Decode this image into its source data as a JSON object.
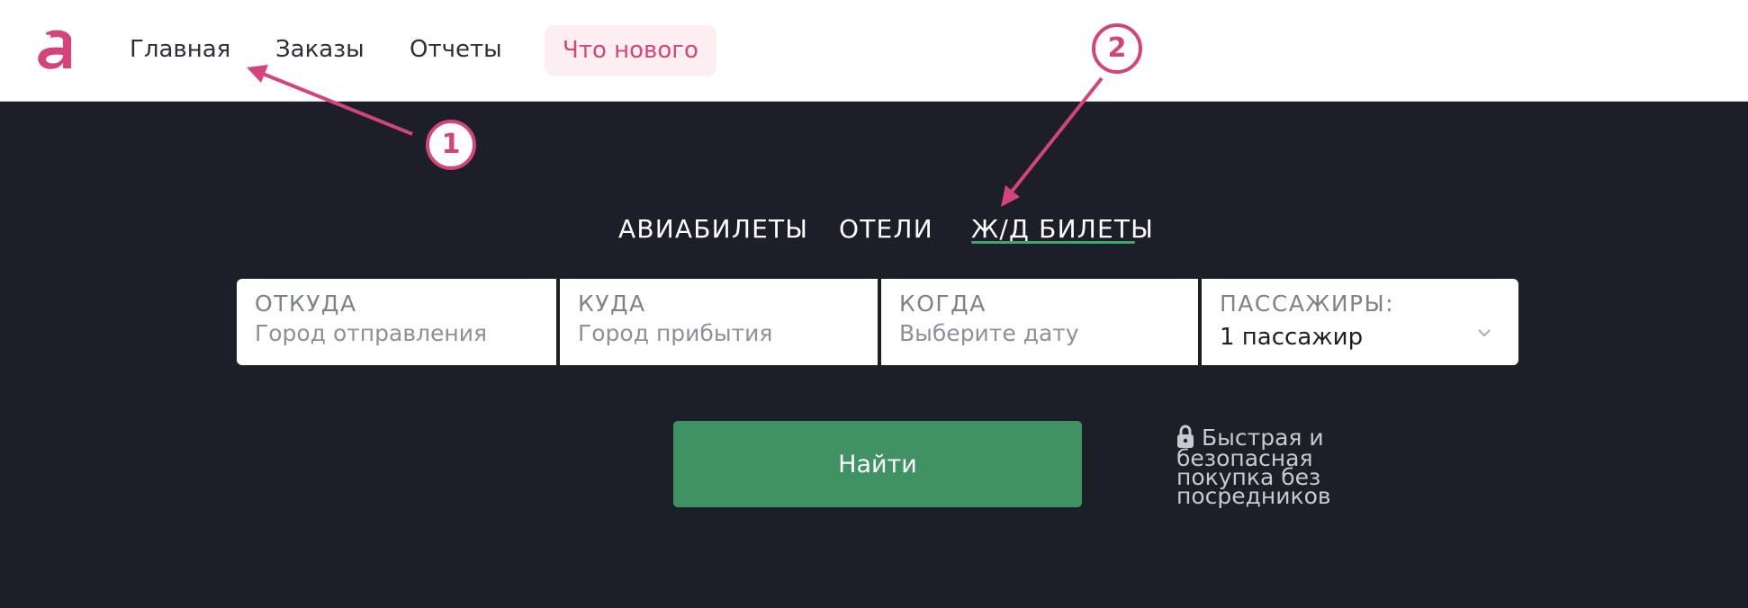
{
  "header": {
    "logo_icon": "brand-logo-icon",
    "nav": [
      {
        "label": "Главная"
      },
      {
        "label": "Заказы"
      },
      {
        "label": "Отчеты"
      },
      {
        "label": "Что нового"
      }
    ]
  },
  "tabs": [
    {
      "label": "АВИАБИЛЕТЫ"
    },
    {
      "label": "ОТЕЛИ"
    },
    {
      "label": "Ж/Д БИЛЕТЫ",
      "active": true
    }
  ],
  "search": {
    "from": {
      "label": "ОТКУДА",
      "placeholder": "Город отправления"
    },
    "to": {
      "label": "КУДА",
      "placeholder": "Город прибытия"
    },
    "when": {
      "label": "КОГДА",
      "placeholder": "Выберите дату"
    },
    "passengers": {
      "label": "ПАССАЖИРЫ:",
      "value": "1 пассажир"
    },
    "button_label": "Найти",
    "secure_note": "Быстрая и безопасная покупка без посредников"
  },
  "annotations": [
    {
      "number": "1"
    },
    {
      "number": "2"
    }
  ],
  "colors": {
    "brand": "#d3457a",
    "accent_green": "#409265",
    "tab_underline": "#3ea76a",
    "background": "#1c1f27"
  }
}
